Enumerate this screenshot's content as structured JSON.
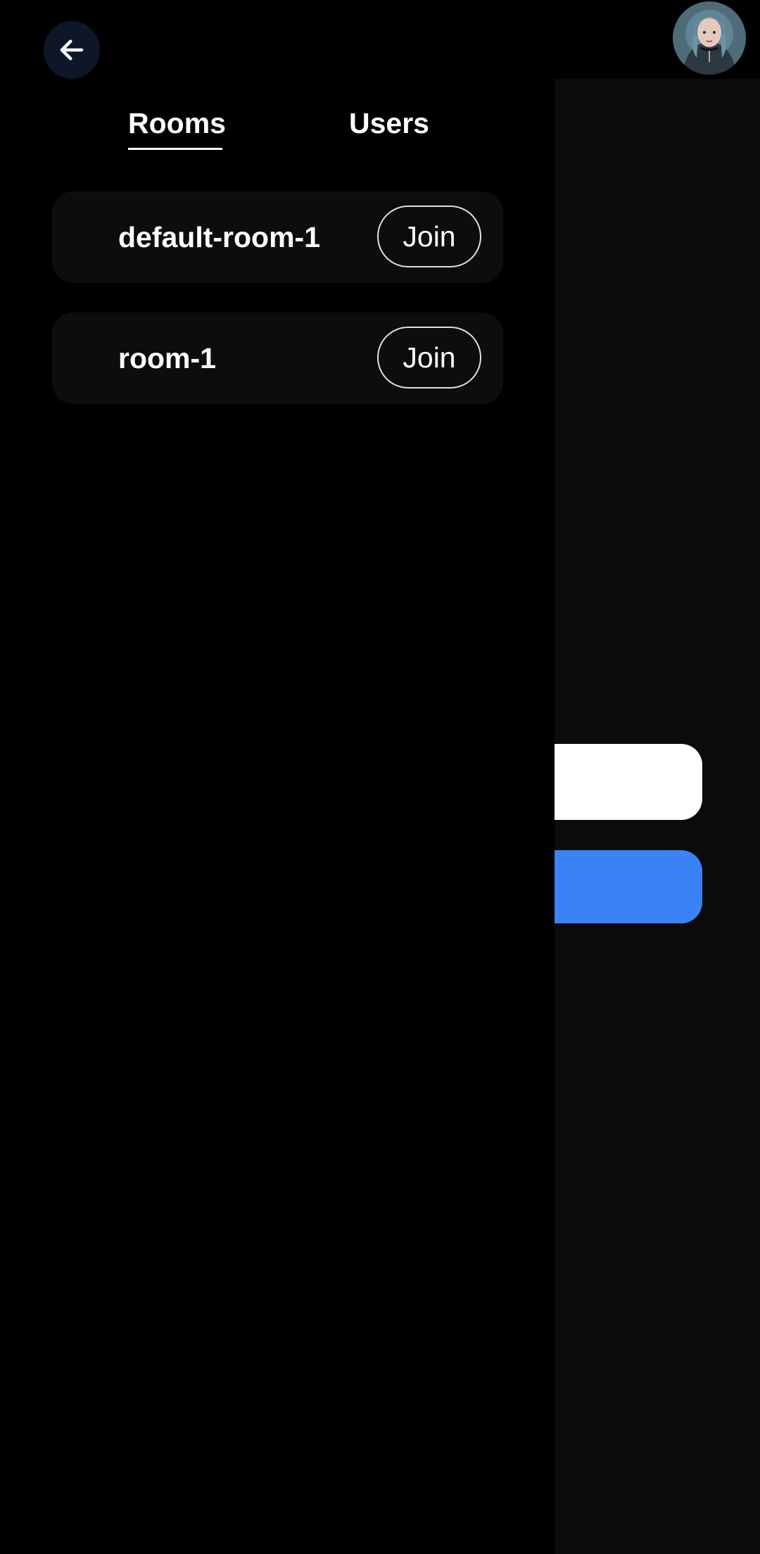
{
  "tabs": {
    "rooms_label": "Rooms",
    "users_label": "Users",
    "active": "Rooms"
  },
  "rooms": [
    {
      "name": "default-room-1",
      "join_label": "Join"
    },
    {
      "name": "room-1",
      "join_label": "Join"
    }
  ],
  "icons": {
    "back": "arrow-left-icon",
    "avatar": "user-avatar"
  },
  "colors": {
    "background": "#000000",
    "back_button_bg": "#0e1629",
    "card_bg": "#0d0d0d",
    "behind_panel_bg": "#0b0b0b",
    "primary_button": "#3b82f6"
  }
}
